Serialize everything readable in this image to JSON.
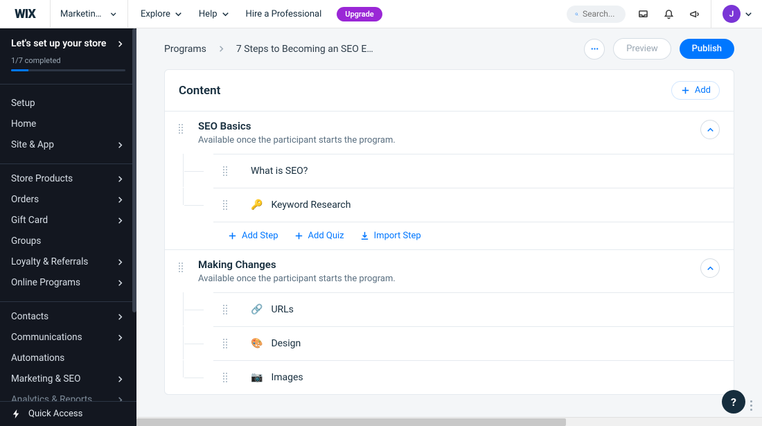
{
  "top": {
    "logo": "WIX",
    "selector": "Marketing ...",
    "nav": [
      "Explore",
      "Help",
      "Hire a Professional"
    ],
    "upgrade": "Upgrade",
    "search_placeholder": "Search...",
    "avatar_initial": "J"
  },
  "sidebar": {
    "setup_title": "Let's set up your store",
    "progress_label": "1/7 completed",
    "progress_fraction": 0.15,
    "groups": [
      {
        "items": [
          {
            "label": "Setup",
            "arrow": false
          },
          {
            "label": "Home",
            "arrow": false
          },
          {
            "label": "Site & App",
            "arrow": true
          }
        ]
      },
      {
        "items": [
          {
            "label": "Store Products",
            "arrow": true
          },
          {
            "label": "Orders",
            "arrow": true
          },
          {
            "label": "Gift Card",
            "arrow": true
          },
          {
            "label": "Groups",
            "arrow": false
          },
          {
            "label": "Loyalty & Referrals",
            "arrow": true
          },
          {
            "label": "Online Programs",
            "arrow": true
          }
        ]
      },
      {
        "items": [
          {
            "label": "Contacts",
            "arrow": true
          },
          {
            "label": "Communications",
            "arrow": true
          },
          {
            "label": "Automations",
            "arrow": false
          },
          {
            "label": "Marketing & SEO",
            "arrow": true
          },
          {
            "label": "Analytics & Reports",
            "arrow": true,
            "faded": true
          }
        ]
      }
    ],
    "quick_access": "Quick Access"
  },
  "breadcrumb": {
    "root": "Programs",
    "current": "7 Steps to Becoming an SEO E…"
  },
  "header_actions": {
    "preview": "Preview",
    "publish": "Publish"
  },
  "content": {
    "title": "Content",
    "add": "Add",
    "sections": [
      {
        "title": "SEO Basics",
        "subtitle": "Available once the participant starts the program.",
        "steps": [
          {
            "emoji": "",
            "label": "What is SEO?"
          },
          {
            "emoji": "🔑",
            "label": "Keyword Research"
          }
        ],
        "show_actions": true
      },
      {
        "title": "Making Changes",
        "subtitle": "Available once the participant starts the program.",
        "steps": [
          {
            "emoji": "🔗",
            "label": "URLs"
          },
          {
            "emoji": "🎨",
            "label": "Design"
          },
          {
            "emoji": "📷",
            "label": "Images"
          }
        ],
        "show_actions": false
      }
    ],
    "actions": {
      "add_step": "Add Step",
      "add_quiz": "Add Quiz",
      "import_step": "Import Step"
    }
  },
  "help": "?"
}
